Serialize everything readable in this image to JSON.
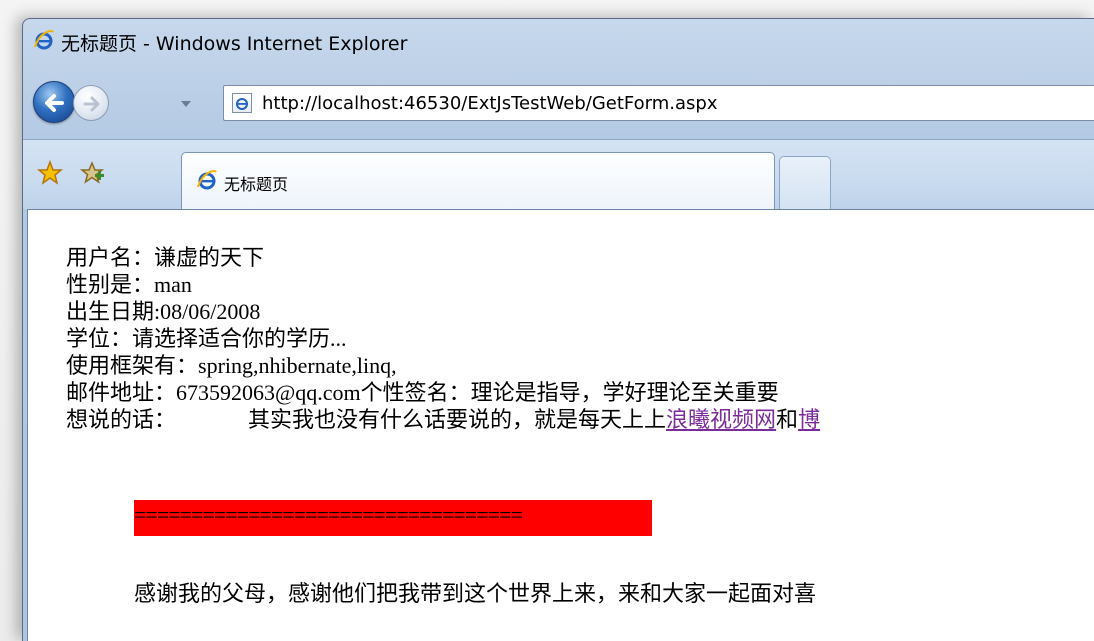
{
  "window": {
    "title": "无标题页 - Windows Internet Explorer"
  },
  "nav": {
    "url": "http://localhost:46530/ExtJsTestWeb/GetForm.aspx"
  },
  "tabs": {
    "active_label": "无标题页"
  },
  "icons": {
    "ie": "ie-logo-icon",
    "back": "back-arrow-icon",
    "forward": "forward-arrow-icon",
    "history": "chevron-down-icon",
    "page": "page-icon",
    "favorites": "favorites-star-icon",
    "add_favorite": "add-favorite-icon"
  },
  "colors": {
    "link": "#7b2b9a",
    "highlight": "#ff0000"
  },
  "content": {
    "username_label": "用户名：",
    "username_value": "谦虚的天下",
    "gender_label": "性别是：",
    "gender_value": "man",
    "birth_label": "出生日期:",
    "birth_value": "08/06/2008",
    "degree_label": "学位：",
    "degree_value": "请选择适合你的学历...",
    "framework_label": "使用框架有：",
    "framework_value": "spring,nhibernate,linq,",
    "email_label": "邮件地址：",
    "email_value": "673592063@qq.com",
    "signature_label": "个性签名：",
    "signature_value": "理论是指导，学好理论至关重要",
    "words_label": "想说的话：",
    "words_text": "其实我也没有什么话要说的，就是每天上上",
    "link1": "浪曦视频网",
    "words_and": "和",
    "link2": "博",
    "separator": "==================================",
    "thanks": "感谢我的父母，感谢他们把我带到这个世界上来，来和大家一起面对喜"
  }
}
